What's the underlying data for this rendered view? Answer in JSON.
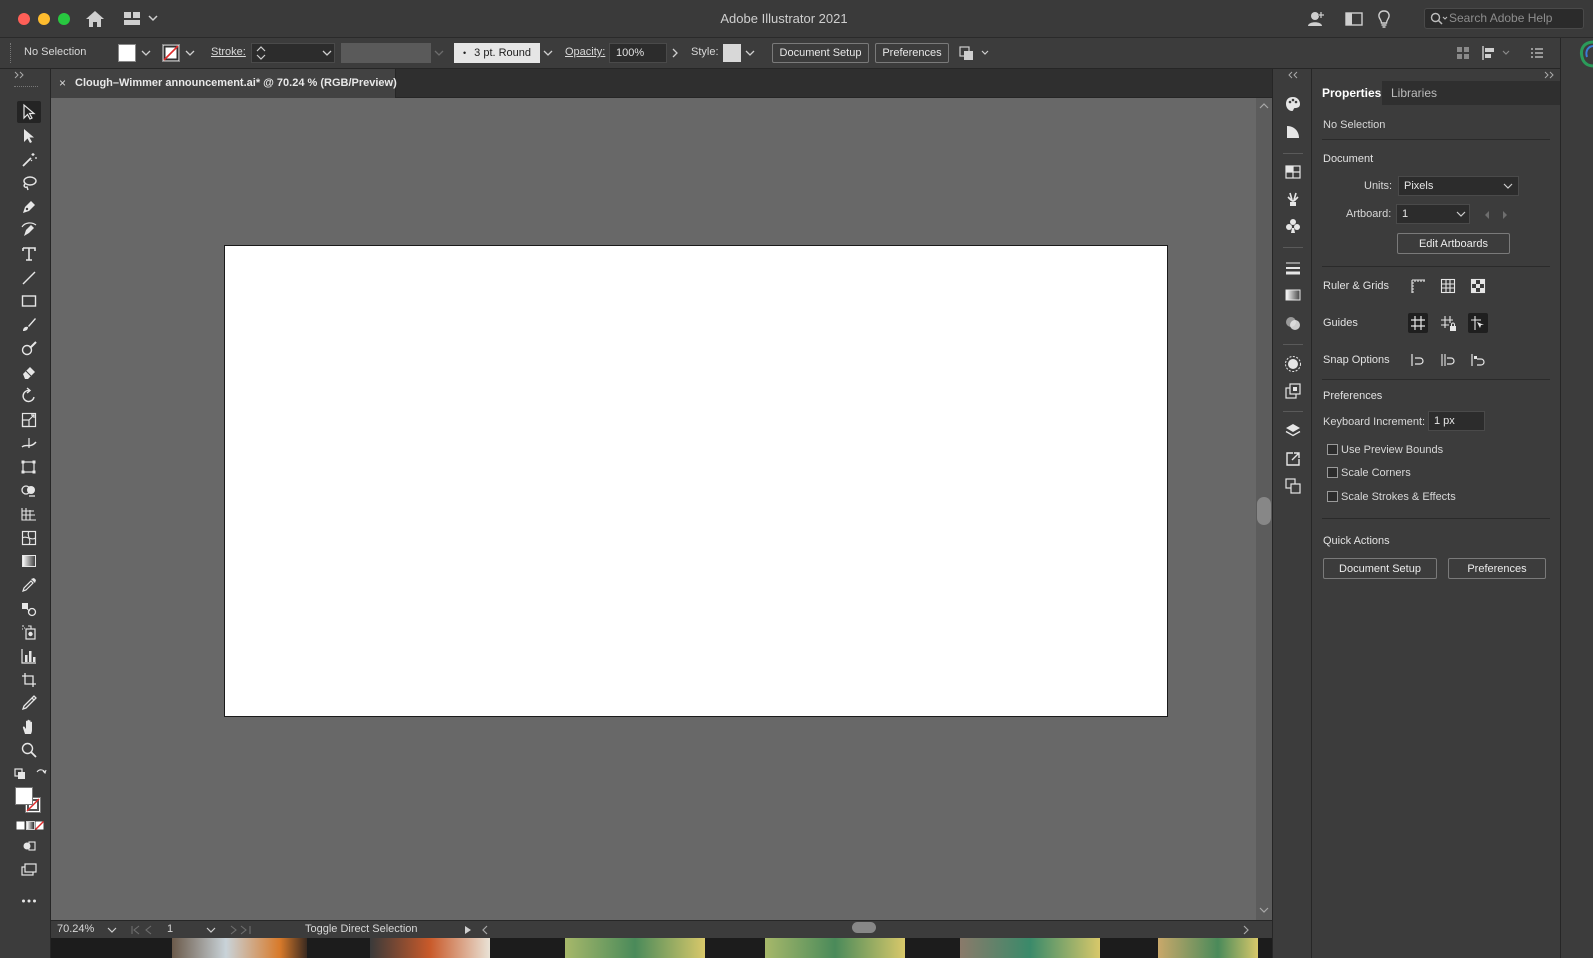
{
  "window": {
    "title": "Adobe Illustrator 2021",
    "search_placeholder": "Search Adobe Help"
  },
  "control_bar": {
    "selection": "No Selection",
    "stroke_label": "Stroke:",
    "brush": "3 pt. Round",
    "opacity_label": "Opacity:",
    "opacity_value": "100%",
    "style_label": "Style:",
    "document_setup": "Document Setup",
    "preferences": "Preferences"
  },
  "document": {
    "tab_close": "×",
    "tab_title": "Clough–Wimmer announcement.ai* @ 70.24 % (RGB/Preview)"
  },
  "status": {
    "zoom": "70.24%",
    "artboard": "1",
    "tool_hint": "Toggle Direct Selection"
  },
  "properties": {
    "tabs": [
      "Properties",
      "Libraries"
    ],
    "selection": "No Selection",
    "document_heading": "Document",
    "units_label": "Units:",
    "units_value": "Pixels",
    "artboard_label": "Artboard:",
    "artboard_value": "1",
    "edit_artboards": "Edit Artboards",
    "ruler_grids": "Ruler & Grids",
    "guides": "Guides",
    "snap_options": "Snap Options",
    "preferences_heading": "Preferences",
    "keyboard_increment_label": "Keyboard Increment:",
    "keyboard_increment_value": "1 px",
    "checkboxes": [
      "Use Preview Bounds",
      "Scale Corners",
      "Scale Strokes & Effects"
    ],
    "quick_actions": "Quick Actions",
    "qa_document_setup": "Document Setup",
    "qa_preferences": "Preferences"
  },
  "colors": {
    "chrome": "#3c3c3c",
    "canvas": "#686868",
    "artboard": "#ffffff",
    "close": "#ff5f57",
    "minimize": "#febc2e",
    "maximize": "#28c840"
  }
}
